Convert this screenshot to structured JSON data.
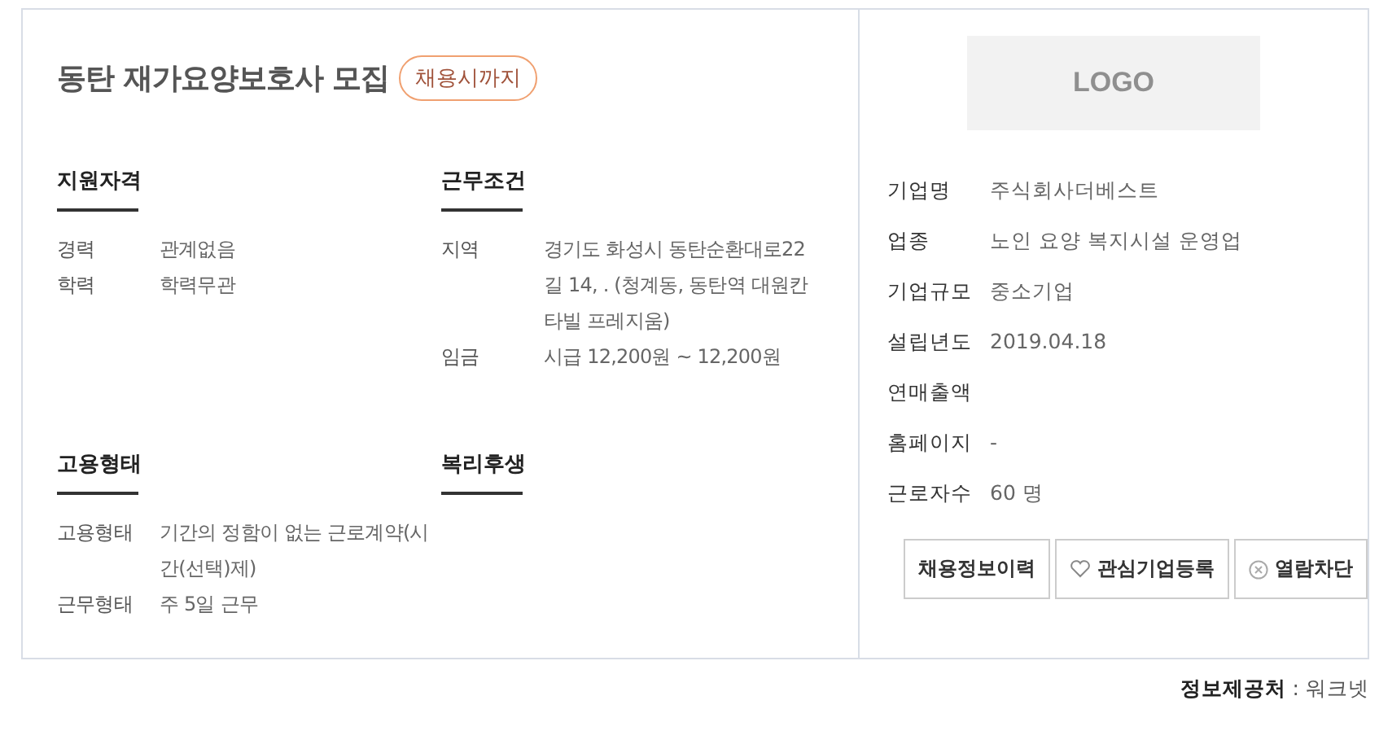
{
  "job": {
    "title": "동탄 재가요양보호사 모집",
    "badge": "채용시까지",
    "sections": [
      {
        "heading": "지원자격",
        "rows": [
          {
            "label": "경력",
            "value": "관계없음"
          },
          {
            "label": "학력",
            "value": "학력무관"
          }
        ]
      },
      {
        "heading": "근무조건",
        "rows": [
          {
            "label": "지역",
            "value": "경기도 화성시 동탄순환대로22길 14, . (청계동, 동탄역 대원칸타빌 프레지움)"
          },
          {
            "label": "임금",
            "value": "시급 12,200원 ~ 12,200원"
          }
        ]
      },
      {
        "heading": "고용형태",
        "rows": [
          {
            "label": "고용형태",
            "value": "기간의 정함이 없는 근로계약(시간(선택)제)"
          },
          {
            "label": "근무형태",
            "value": "주 5일 근무"
          }
        ]
      },
      {
        "heading": "복리후생"
      }
    ]
  },
  "company": {
    "logo": "LOGO",
    "rows": [
      {
        "label": "기업명",
        "value": "주식회사더베스트"
      },
      {
        "label": "업종",
        "value": "노인 요양 복지시설 운영업"
      },
      {
        "label": "기업규모",
        "value": "중소기업"
      },
      {
        "label": "설립년도",
        "value": "2019.04.18"
      },
      {
        "label": "연매출액"
      },
      {
        "label": "홈페이지",
        "value": "-"
      },
      {
        "label": "근로자수",
        "value": "60 명"
      }
    ],
    "buttons": [
      {
        "label": "채용정보이력",
        "kind": "plain"
      },
      {
        "label": "관심기업등록",
        "kind": "favorite"
      },
      {
        "label": "열람차단",
        "kind": "block"
      }
    ]
  },
  "footer": "**정보제공처** : 워크넷"
}
